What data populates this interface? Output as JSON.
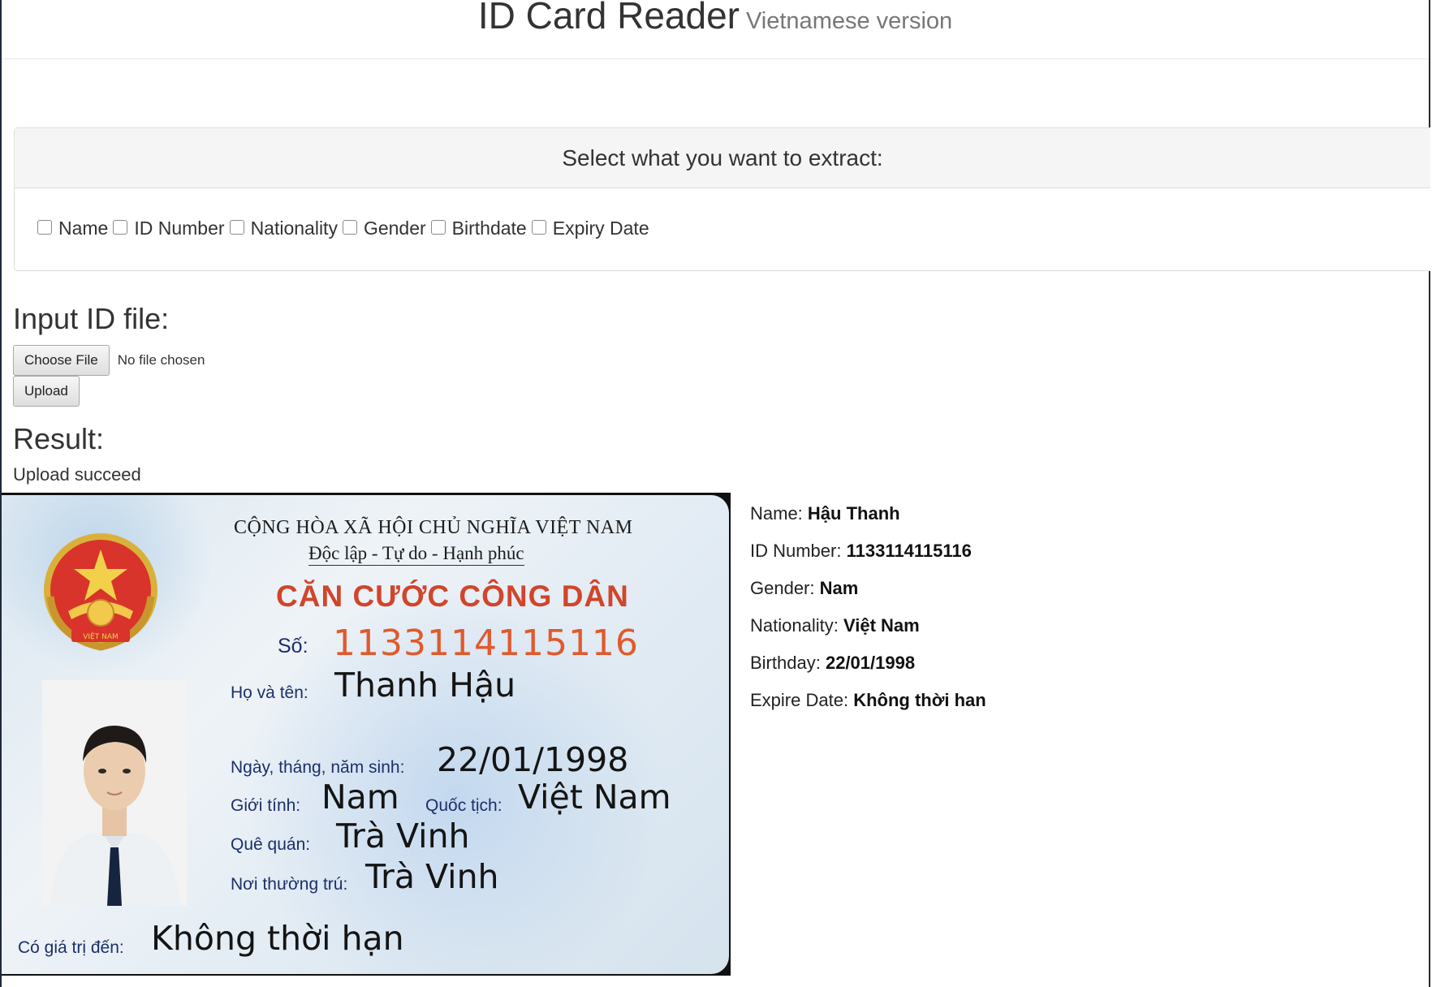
{
  "header": {
    "title": "ID Card Reader",
    "subtitle": "Vietnamese version"
  },
  "extract_panel": {
    "heading": "Select what you want to extract:",
    "options": [
      "Name",
      "ID Number",
      "Nationality",
      "Gender",
      "Birthdate",
      "Expiry Date"
    ]
  },
  "input": {
    "title": "Input ID file:",
    "choose_file_label": "Choose File",
    "file_status": "No file chosen",
    "upload_label": "Upload"
  },
  "result": {
    "title": "Result:",
    "status": "Upload succeed",
    "fields": [
      {
        "label": "Name:",
        "value": "Hậu Thanh"
      },
      {
        "label": "ID Number:",
        "value": "113311411511​6"
      },
      {
        "label": "Gender:",
        "value": "Nam"
      },
      {
        "label": "Nationality:",
        "value": "Việt Nam"
      },
      {
        "label": "Birthday:",
        "value": "22/01/1998"
      },
      {
        "label": "Expire Date:",
        "value": "Không thời han"
      }
    ]
  },
  "card": {
    "line1": "CỘNG HÒA XÃ HỘI CHỦ NGHĨA VIỆT NAM",
    "line2": "Độc lập - Tự do - Hạnh phúc",
    "heading": "CĂN CƯỚC CÔNG DÂN",
    "emblem_text": "VIỆT NAM",
    "number_label": "Số:",
    "number": "113311411511​6",
    "name_label": "Họ và tên:",
    "name": "Thanh Hậu",
    "dob_label": "Ngày, tháng, năm sinh:",
    "dob": "22/01/1998",
    "gender_label": "Giới tính:",
    "gender": "Nam",
    "nationality_label": "Quốc tịch:",
    "nationality": "Việt Nam",
    "hometown_label": "Quê quán:",
    "hometown": "Trà Vinh",
    "residence_label": "Nơi thường trú:",
    "residence": "Trà Vinh",
    "expiry_label": "Có giá trị đến:",
    "expiry": "Không thời hạn"
  }
}
